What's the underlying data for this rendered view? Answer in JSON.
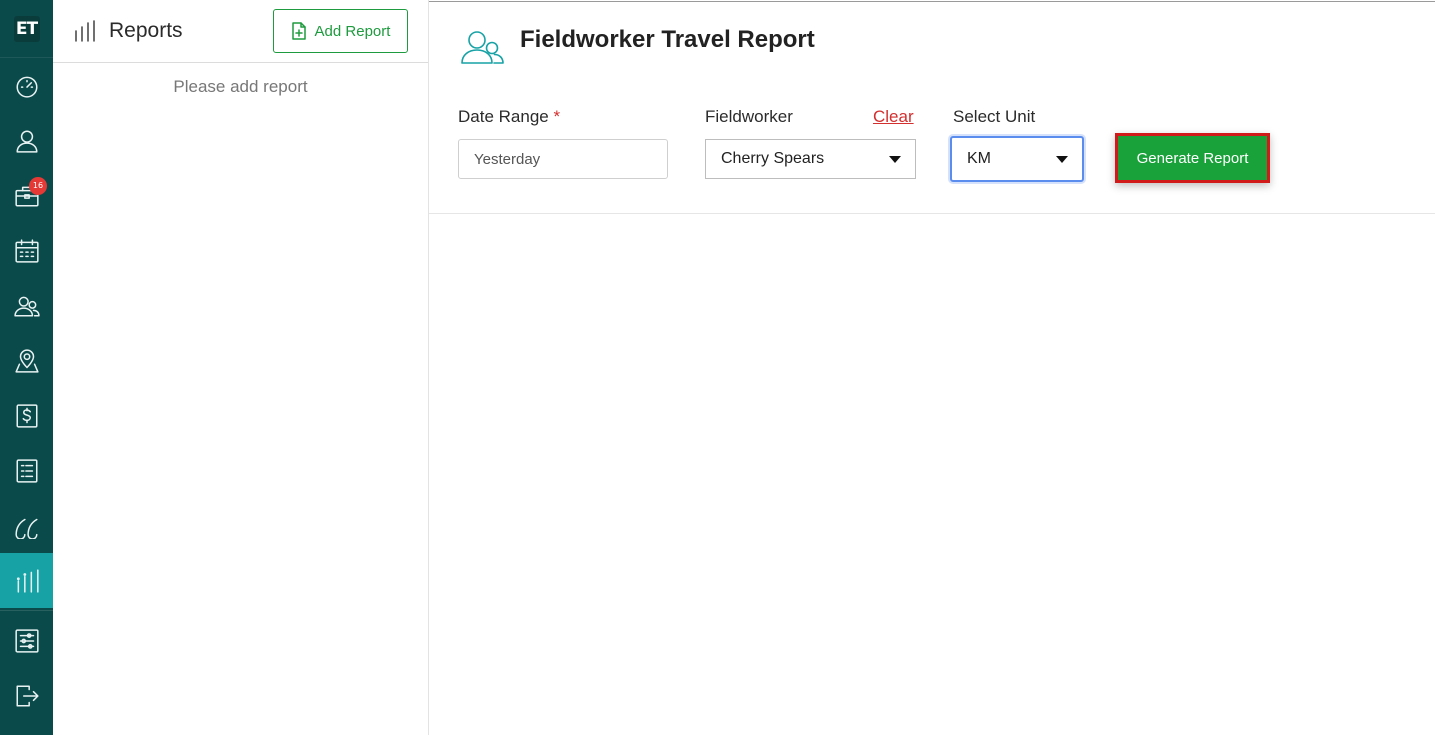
{
  "rail": {
    "logo": "ET",
    "notification_badge": "16",
    "items": [
      {
        "name": "dashboard",
        "icon": "gauge-icon"
      },
      {
        "name": "profile",
        "icon": "user-icon"
      },
      {
        "name": "jobs",
        "icon": "briefcase-icon"
      },
      {
        "name": "calendar",
        "icon": "calendar-icon"
      },
      {
        "name": "fieldworkers",
        "icon": "users-icon"
      },
      {
        "name": "locations",
        "icon": "map-pin-icon"
      },
      {
        "name": "billing",
        "icon": "dollar-icon"
      },
      {
        "name": "lists",
        "icon": "list-icon"
      },
      {
        "name": "quotes",
        "icon": "quote-icon"
      },
      {
        "name": "reports",
        "icon": "bar-chart-icon",
        "active": true
      },
      {
        "name": "settings",
        "icon": "sliders-icon"
      },
      {
        "name": "logout",
        "icon": "logout-icon"
      }
    ],
    "active_color": "#17a2a6",
    "bg_color": "#0b4a4a"
  },
  "reports_panel": {
    "title": "Reports",
    "add_button_label": "Add Report",
    "empty_message": "Please add report"
  },
  "main": {
    "page_title": "Fieldworker Travel Report",
    "filters": {
      "date_range_label": "Date Range",
      "required_mark": "*",
      "date_range_value": "Yesterday",
      "fieldworker_label": "Fieldworker",
      "clear_label": "Clear",
      "fieldworker_value": "Cherry Spears",
      "unit_label": "Select Unit",
      "unit_value": "KM"
    },
    "generate_button_label": "Generate Report",
    "accent_green": "#19a13a",
    "highlight_red": "#d11a1a"
  }
}
